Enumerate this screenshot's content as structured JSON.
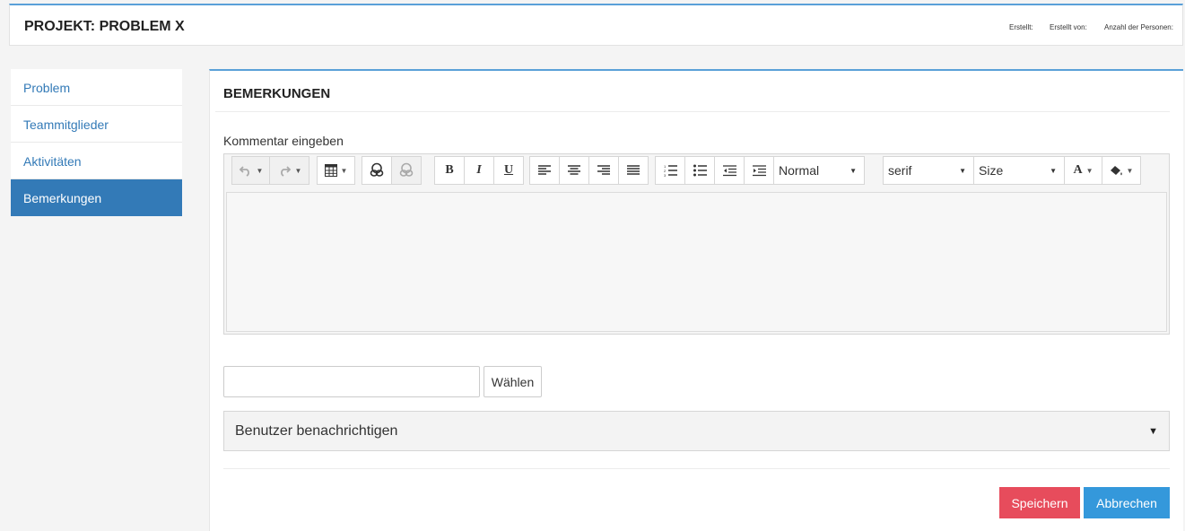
{
  "header": {
    "title": "PROJEKT: PROBLEM X",
    "created_label": "Erstellt:",
    "created_by_label": "Erstellt von:",
    "persons_label": "Anzahl der Personen:"
  },
  "sidebar": {
    "items": [
      {
        "label": "Problem",
        "active": false
      },
      {
        "label": "Teammitglieder",
        "active": false
      },
      {
        "label": "Aktivitäten",
        "active": false
      },
      {
        "label": "Bemerkungen",
        "active": true
      }
    ]
  },
  "panel": {
    "title": "BEMERKUNGEN",
    "comment_label": "Kommentar eingeben"
  },
  "toolbar": {
    "bold_label": "B",
    "italic_label": "I",
    "underline_label": "U",
    "format_select": "Normal",
    "font_select": "serif",
    "size_select": "Size",
    "text_color_label": "A"
  },
  "file": {
    "choose_label": "Wählen"
  },
  "notify": {
    "label": "Benutzer benachrichtigen"
  },
  "actions": {
    "save_label": "Speichern",
    "cancel_label": "Abbrechen"
  },
  "colors": {
    "accent": "#337ab7",
    "header_border": "#5aa0d8",
    "save": "#e74c5c",
    "cancel": "#3498db"
  }
}
